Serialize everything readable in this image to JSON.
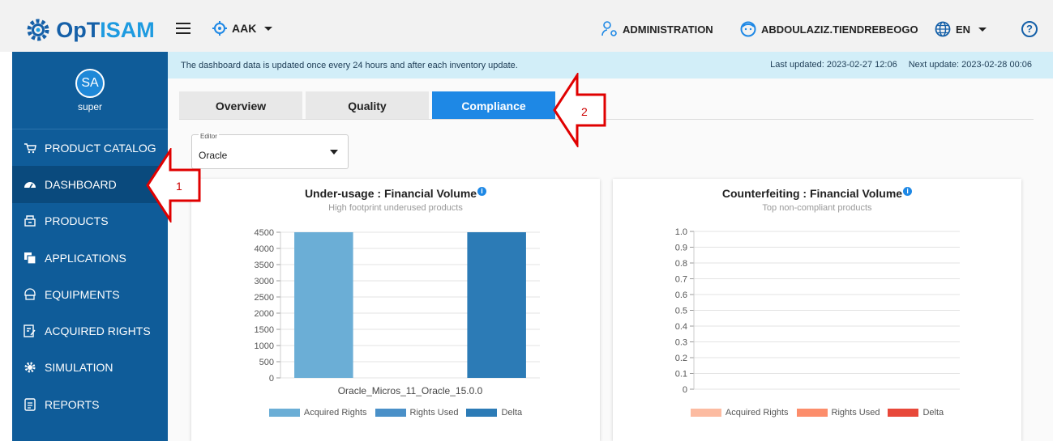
{
  "app": {
    "logo": "OpTISAM",
    "logo_part1": "OpT",
    "logo_part2": "ISAM"
  },
  "header": {
    "tenant": "AAK",
    "admin": "ADMINISTRATION",
    "user": "ABDOULAZIZ.TIENDREBEOGO",
    "lang": "EN",
    "help": "?"
  },
  "sidebar": {
    "avatar_initials": "SA",
    "username": "super",
    "items": [
      {
        "label": "PRODUCT CATALOG",
        "icon": "cart-icon"
      },
      {
        "label": "DASHBOARD",
        "icon": "gauge-icon"
      },
      {
        "label": "PRODUCTS",
        "icon": "package-icon"
      },
      {
        "label": "APPLICATIONS",
        "icon": "copy-icon"
      },
      {
        "label": "EQUIPMENTS",
        "icon": "server-icon"
      },
      {
        "label": "ACQUIRED RIGHTS",
        "icon": "edit-doc-icon"
      },
      {
        "label": "SIMULATION",
        "icon": "cog-icon"
      },
      {
        "label": "REPORTS",
        "icon": "report-icon"
      }
    ]
  },
  "banner": {
    "message": "The dashboard data is updated once every 24 hours and after each inventory update.",
    "last_updated": "Last updated: 2023-02-27 12:06",
    "next_update": "Next update: 2023-02-28 00:06"
  },
  "tabs": [
    {
      "label": "Overview"
    },
    {
      "label": "Quality"
    },
    {
      "label": "Compliance"
    }
  ],
  "editor": {
    "label": "Editor",
    "value": "Oracle"
  },
  "annotations": {
    "one": "1",
    "two": "2"
  },
  "colors": {
    "primary": "#1e88e5",
    "sidebar": "#0f5c99",
    "annotation": "#e00000"
  },
  "chart_data": [
    {
      "type": "bar",
      "title": "Under-usage : Financial Volume",
      "subtitle": "High footprint underused products",
      "categories": [
        "Oracle_Micros_11_Oracle_15.0.0"
      ],
      "series": [
        {
          "name": "Acquired Rights",
          "values": [
            4500
          ],
          "color": "#6baed6"
        },
        {
          "name": "Rights Used",
          "values": [
            0
          ],
          "color": "#4a90c8"
        },
        {
          "name": "Delta",
          "values": [
            4500
          ],
          "color": "#2c7bb6"
        }
      ],
      "yticks": [
        "4500",
        "4000",
        "3500",
        "3000",
        "2500",
        "2000",
        "1500",
        "1000",
        "500",
        "0"
      ],
      "ylim": [
        0,
        4500
      ],
      "legend": "bottom"
    },
    {
      "type": "bar",
      "title": "Counterfeiting : Financial Volume",
      "subtitle": "Top non-compliant products",
      "categories": [],
      "series": [
        {
          "name": "Acquired Rights",
          "values": [],
          "color": "#fcbba1"
        },
        {
          "name": "Rights Used",
          "values": [],
          "color": "#fc8d6b"
        },
        {
          "name": "Delta",
          "values": [],
          "color": "#e8483a"
        }
      ],
      "yticks": [
        "1.0",
        "0.9",
        "0.8",
        "0.7",
        "0.6",
        "0.5",
        "0.4",
        "0.3",
        "0.2",
        "0.1",
        "0"
      ],
      "ylim": [
        0,
        1.0
      ],
      "legend": "bottom"
    }
  ]
}
